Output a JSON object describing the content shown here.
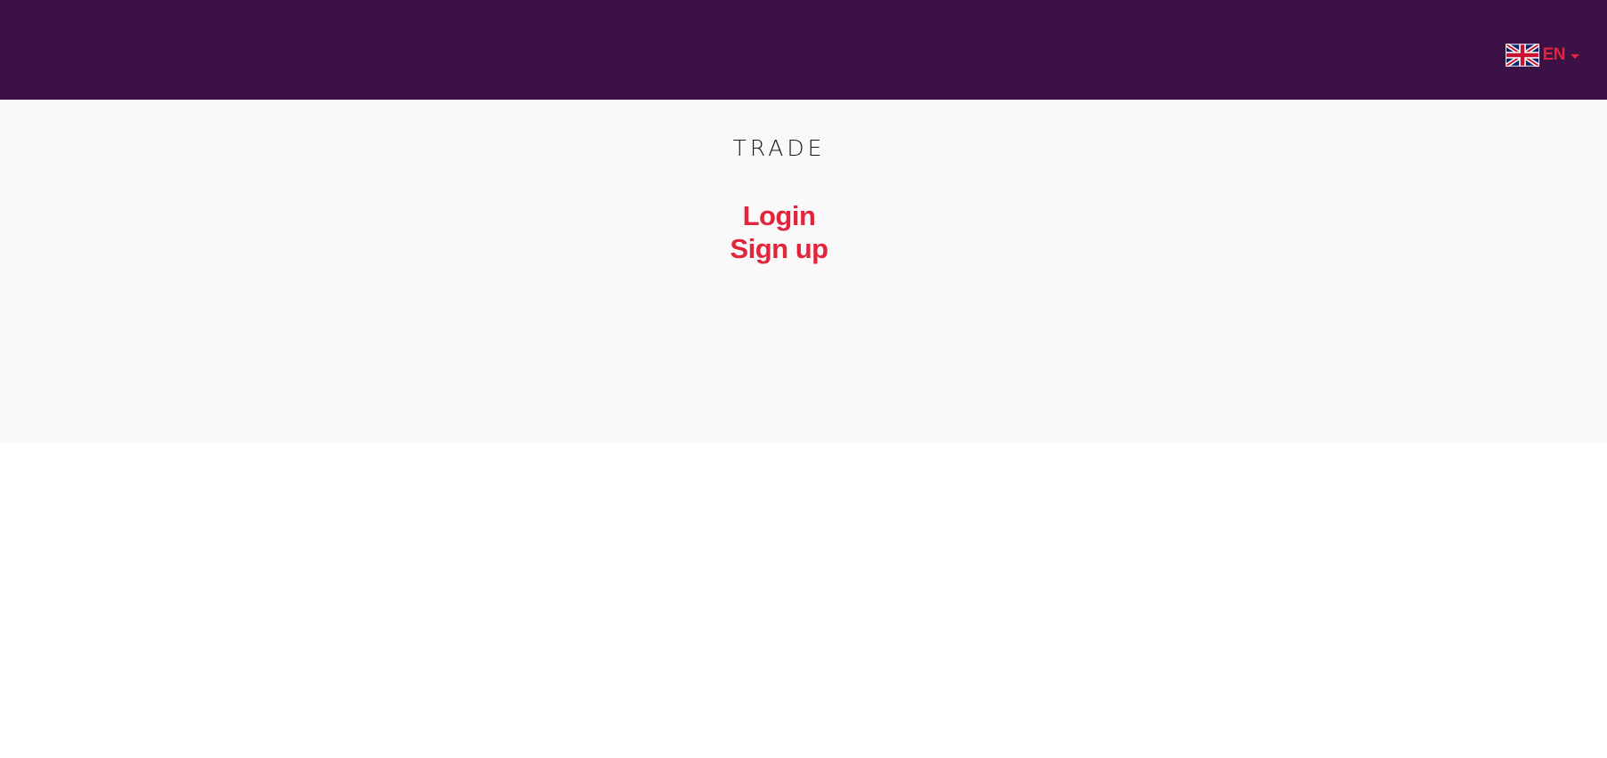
{
  "header": {
    "background_color": "#3c1146",
    "language": {
      "flag_icon": "uk-flag-icon",
      "label": "EN",
      "caret_icon": "caret-down-icon",
      "color": "#e2253a"
    }
  },
  "main": {
    "title": "TRADE",
    "links": {
      "login": "Login",
      "signup": "Sign up"
    },
    "link_color": "#e2253a"
  }
}
